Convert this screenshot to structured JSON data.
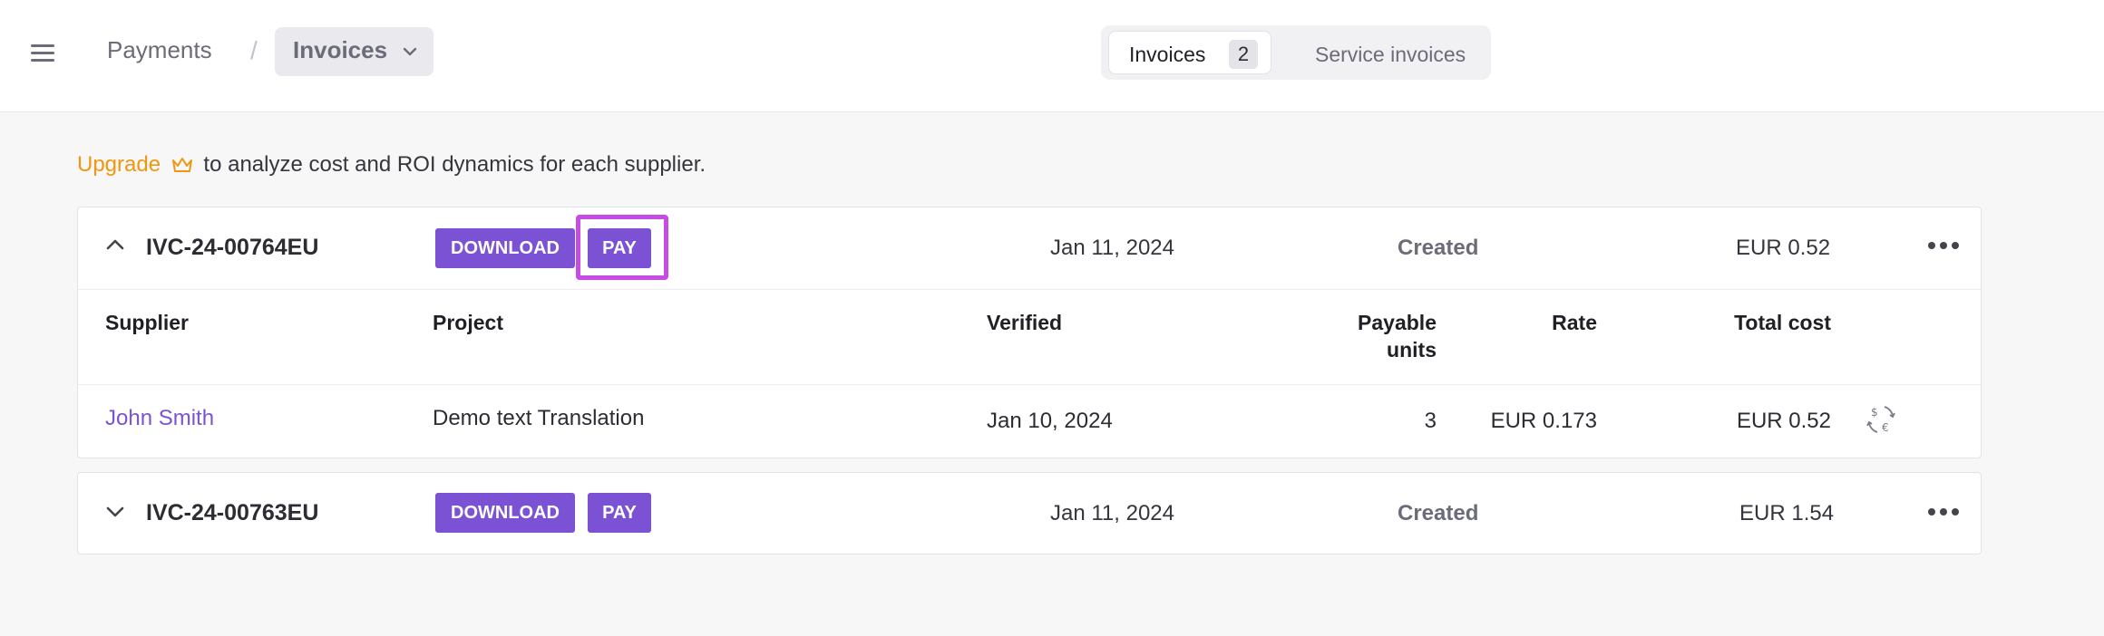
{
  "header": {
    "breadcrumb_parent": "Payments",
    "breadcrumb_separator": "/",
    "breadcrumb_current": "Invoices",
    "tabs": [
      {
        "label": "Invoices",
        "count": "2",
        "active": true
      },
      {
        "label": "Service invoices",
        "active": false
      }
    ]
  },
  "promo": {
    "upgrade_label": "Upgrade",
    "text": "to analyze cost and ROI dynamics for each supplier."
  },
  "colors": {
    "accent": "#7b52d3",
    "upgrade": "#f1960f",
    "highlight": "#c94be5"
  },
  "invoices": [
    {
      "id": "IVC-24-00764EU",
      "download_label": "DOWNLOAD",
      "pay_label": "PAY",
      "date": "Jan 11, 2024",
      "status": "Created",
      "amount": "EUR 0.52",
      "expanded": true,
      "columns": {
        "supplier": "Supplier",
        "project": "Project",
        "verified": "Verified",
        "payable_units_line1": "Payable",
        "payable_units_line2": "units",
        "rate": "Rate",
        "total_cost": "Total cost"
      },
      "rows": [
        {
          "supplier": "John Smith",
          "project": "Demo text Translation",
          "verified": "Jan 10, 2024",
          "payable_units": "3",
          "rate": "EUR 0.173",
          "total_cost": "EUR 0.52"
        }
      ]
    },
    {
      "id": "IVC-24-00763EU",
      "download_label": "DOWNLOAD",
      "pay_label": "PAY",
      "date": "Jan 11, 2024",
      "status": "Created",
      "amount": "EUR 1.54",
      "expanded": false
    }
  ]
}
